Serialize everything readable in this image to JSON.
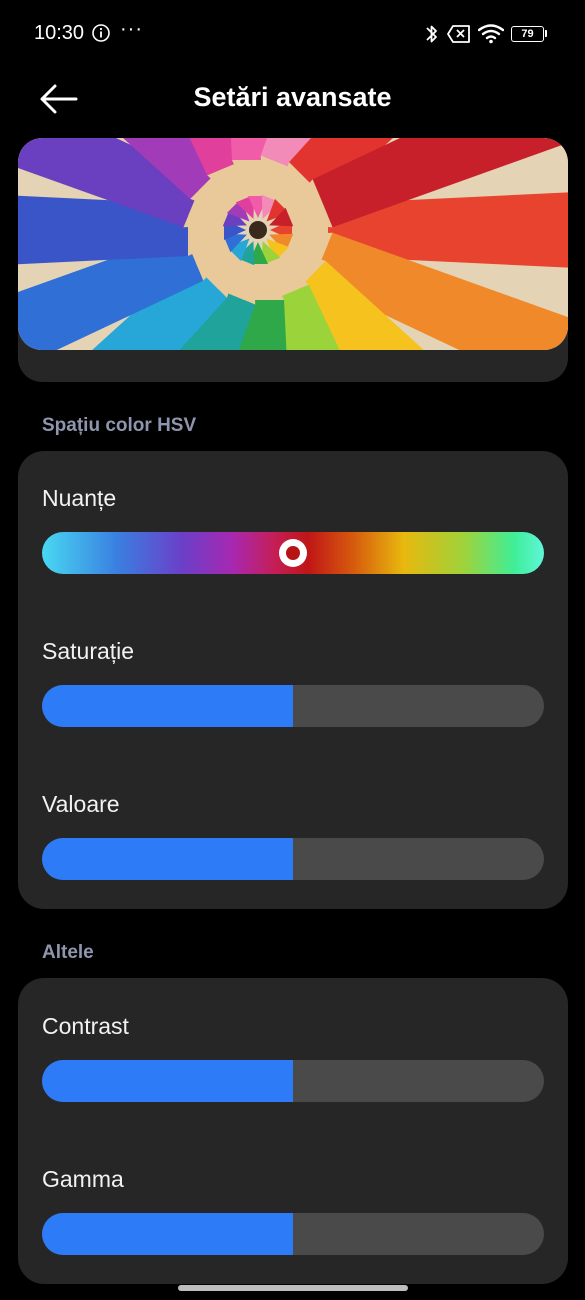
{
  "status_bar": {
    "time": "10:30",
    "more_dots": "···",
    "battery_level": "79",
    "icons": [
      "info-icon",
      "bluetooth-icon",
      "sim-off-icon",
      "wifi-icon",
      "battery-icon"
    ]
  },
  "header": {
    "title": "Setări avansate",
    "back_icon": "arrow-left-icon"
  },
  "preview": {
    "image": "colored-pencils-photo"
  },
  "sections": {
    "hsv": {
      "label": "Spațiu color HSV",
      "hue_label": "Nuanțe",
      "hue_position": 0.5,
      "saturation_label": "Saturație",
      "saturation_value": 0.5,
      "value_label": "Valoare",
      "value_value": 0.5
    },
    "other": {
      "label": "Altele",
      "contrast_label": "Contrast",
      "contrast_value": 0.5,
      "gamma_label": "Gamma",
      "gamma_value": 0.5
    }
  },
  "colors": {
    "accent": "#2d7bf6",
    "track": "#4a4a4a",
    "card": "#262626",
    "section_label": "#8f95ad",
    "background": "#000000"
  }
}
